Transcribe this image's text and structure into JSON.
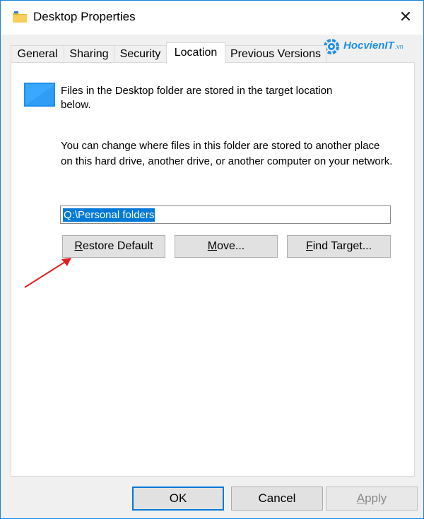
{
  "window": {
    "title": "Desktop Properties",
    "close_symbol": "✕"
  },
  "watermark": {
    "brand": "HocvienIT",
    "suffix": ".vn"
  },
  "tabs": [
    {
      "label": "General"
    },
    {
      "label": "Sharing"
    },
    {
      "label": "Security"
    },
    {
      "label": "Location",
      "active": true
    },
    {
      "label": "Previous Versions"
    }
  ],
  "location": {
    "info_text": "Files in the Desktop folder are stored in the target location below.",
    "description": "You can change where files in this folder are stored to another place on this hard drive, another drive, or another computer on your network.",
    "path_value": "Q:\\Personal folders",
    "buttons": {
      "restore_first": "R",
      "restore_rest": "estore Default",
      "move_first": "M",
      "move_rest": "ove...",
      "find_first": "F",
      "find_rest": "ind Target..."
    }
  },
  "footer": {
    "ok": "OK",
    "cancel": "Cancel",
    "apply_first": "A",
    "apply_rest": "pply"
  },
  "colors": {
    "accent": "#0078d7",
    "watermark": "#1e90e8",
    "annotation_arrow": "#e02020"
  },
  "icons": {
    "title": "folder-icon",
    "location": "desktop-folder-icon",
    "annotation": "red-arrow-icon"
  }
}
